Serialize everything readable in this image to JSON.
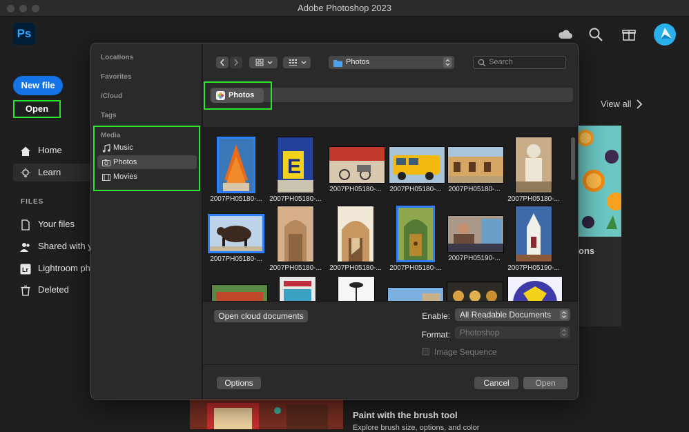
{
  "window": {
    "title": "Adobe Photoshop 2023"
  },
  "app": {
    "logo": "Ps",
    "icons": [
      "cloud-icon",
      "search-icon",
      "gift-icon",
      "avatar"
    ],
    "accent": "#1473e6",
    "highlight": "#2ee52e"
  },
  "sidebar": {
    "new_file": "New file",
    "open": "Open",
    "nav": [
      {
        "label": "Home",
        "icon": "home-icon"
      },
      {
        "label": "Learn",
        "icon": "lightbulb-icon",
        "selected": true
      }
    ],
    "files_heading": "FILES",
    "files": [
      {
        "label": "Your files",
        "icon": "file-icon"
      },
      {
        "label": "Shared with yo",
        "icon": "people-icon"
      },
      {
        "label": "Lightroom pho",
        "icon": "lightroom-icon"
      },
      {
        "label": "Deleted",
        "icon": "trash-icon"
      }
    ]
  },
  "background": {
    "view_all": "View all",
    "card_text": "ons",
    "brush_title": "Paint with the brush tool",
    "brush_sub": "Explore brush size, options, and color"
  },
  "dialog": {
    "sidebar": {
      "headings": {
        "locations": "Locations",
        "favorites": "Favorites",
        "icloud": "iCloud",
        "tags": "Tags",
        "media": "Media"
      },
      "media_items": [
        {
          "label": "Music",
          "icon": "music-icon"
        },
        {
          "label": "Photos",
          "icon": "camera-icon",
          "selected": true
        },
        {
          "label": "Movies",
          "icon": "film-icon"
        }
      ]
    },
    "toolbar": {
      "location": "Photos",
      "search_placeholder": "Search"
    },
    "path_tag": "Photos",
    "thumbnails": [
      {
        "caption": "2007PH05180-...",
        "selected": true
      },
      {
        "caption": "2007PH05180-..."
      },
      {
        "caption": "2007PH05180-..."
      },
      {
        "caption": "2007PH05180-..."
      },
      {
        "caption": "2007PH05180-..."
      },
      {
        "caption": "2007PH05180-..."
      },
      {
        "caption": "2007PH05180-...",
        "selected": true
      },
      {
        "caption": "2007PH05180-..."
      },
      {
        "caption": "2007PH05180-..."
      },
      {
        "caption": "2007PH05180-...",
        "selected": true
      },
      {
        "caption": "2007PH05190-..."
      },
      {
        "caption": "2007PH05190-..."
      }
    ],
    "bottom": {
      "cloud_button": "Open cloud documents",
      "enable_label": "Enable:",
      "enable_value": "All Readable Documents",
      "format_label": "Format:",
      "format_value": "Photoshop",
      "image_sequence": "Image Sequence",
      "options": "Options",
      "cancel": "Cancel",
      "open": "Open"
    }
  }
}
